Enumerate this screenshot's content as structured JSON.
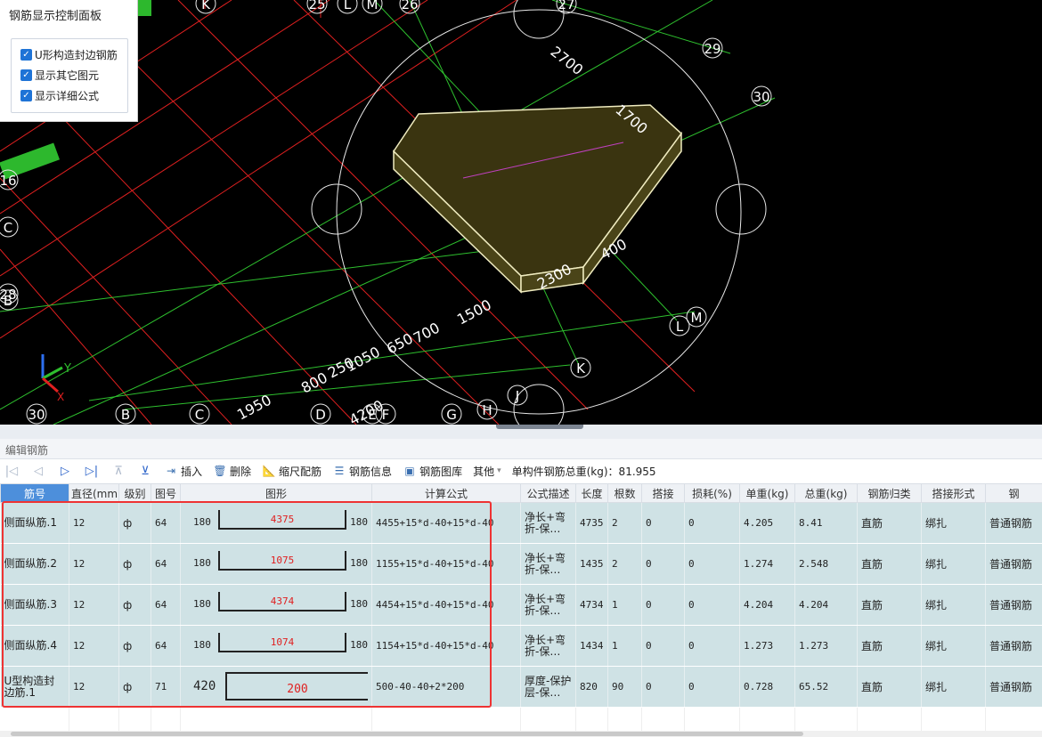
{
  "panel": {
    "title": "钢筋显示控制面板",
    "options": [
      {
        "label": "U形构造封边钢筋",
        "checked": true
      },
      {
        "label": "显示其它图元",
        "checked": true
      },
      {
        "label": "显示详细公式",
        "checked": true
      }
    ]
  },
  "viewport": {
    "dims": [
      "2700",
      "1700",
      "400",
      "2300",
      "1500",
      "800",
      "250",
      "1050",
      "650",
      "700",
      "1950",
      "4200"
    ],
    "axes_top": [
      "K",
      "25",
      "L",
      "M",
      "26",
      "27",
      "29",
      "30"
    ],
    "axes_bottom": [
      "30",
      "B",
      "C",
      "D",
      "E",
      "F",
      "G",
      "H",
      "J",
      "K",
      "L",
      "M"
    ],
    "axes_left": [
      "16",
      "C",
      "28",
      "B"
    ],
    "axis_gizmo": {
      "y": "Y",
      "x": "X"
    }
  },
  "editor": {
    "title": "编辑钢筋",
    "toolbar": {
      "insert": "插入",
      "delete": "删除",
      "scale": "缩尺配筋",
      "info": "钢筋信息",
      "library": "钢筋图库",
      "other": "其他",
      "total": "单构件钢筋总重(kg)：81.955"
    },
    "columns": [
      "筋号",
      "直径(mm)",
      "级别",
      "图号",
      "图形",
      "计算公式",
      "公式描述",
      "长度",
      "根数",
      "搭接",
      "损耗(%)",
      "单重(kg)",
      "总重(kg)",
      "钢筋归类",
      "搭接形式",
      "钢"
    ],
    "rows": [
      {
        "name": "侧面纵筋.1",
        "dia": "12",
        "grade": "ф",
        "fig": "64",
        "left": "180",
        "mid": "4375",
        "right": "180",
        "formula": "4455+15*d-40+15*d-40",
        "desc": "净长+弯折-保…",
        "len": "4735",
        "count": "2",
        "lap": "0",
        "loss": "0",
        "unit": "4.205",
        "total": "8.41",
        "cat": "直筋",
        "lapform": "绑扎",
        "type": "普通钢筋"
      },
      {
        "name": "侧面纵筋.2",
        "dia": "12",
        "grade": "ф",
        "fig": "64",
        "left": "180",
        "mid": "1075",
        "right": "180",
        "formula": "1155+15*d-40+15*d-40",
        "desc": "净长+弯折-保…",
        "len": "1435",
        "count": "2",
        "lap": "0",
        "loss": "0",
        "unit": "1.274",
        "total": "2.548",
        "cat": "直筋",
        "lapform": "绑扎",
        "type": "普通钢筋"
      },
      {
        "name": "侧面纵筋.3",
        "dia": "12",
        "grade": "ф",
        "fig": "64",
        "left": "180",
        "mid": "4374",
        "right": "180",
        "formula": "4454+15*d-40+15*d-40",
        "desc": "净长+弯折-保…",
        "len": "4734",
        "count": "1",
        "lap": "0",
        "loss": "0",
        "unit": "4.204",
        "total": "4.204",
        "cat": "直筋",
        "lapform": "绑扎",
        "type": "普通钢筋"
      },
      {
        "name": "侧面纵筋.4",
        "dia": "12",
        "grade": "ф",
        "fig": "64",
        "left": "180",
        "mid": "1074",
        "right": "180",
        "formula": "1154+15*d-40+15*d-40",
        "desc": "净长+弯折-保…",
        "len": "1434",
        "count": "1",
        "lap": "0",
        "loss": "0",
        "unit": "1.273",
        "total": "1.273",
        "cat": "直筋",
        "lapform": "绑扎",
        "type": "普通钢筋"
      },
      {
        "name": "U型构造封边筋.1",
        "dia": "12",
        "grade": "ф",
        "fig": "71",
        "left": "420",
        "mid": "200",
        "right": "",
        "formula": "500-40-40+2*200",
        "desc": "厚度-保护层-保…",
        "len": "820",
        "count": "90",
        "lap": "0",
        "loss": "0",
        "unit": "0.728",
        "total": "65.52",
        "cat": "直筋",
        "lapform": "绑扎",
        "type": "普通钢筋"
      }
    ]
  }
}
